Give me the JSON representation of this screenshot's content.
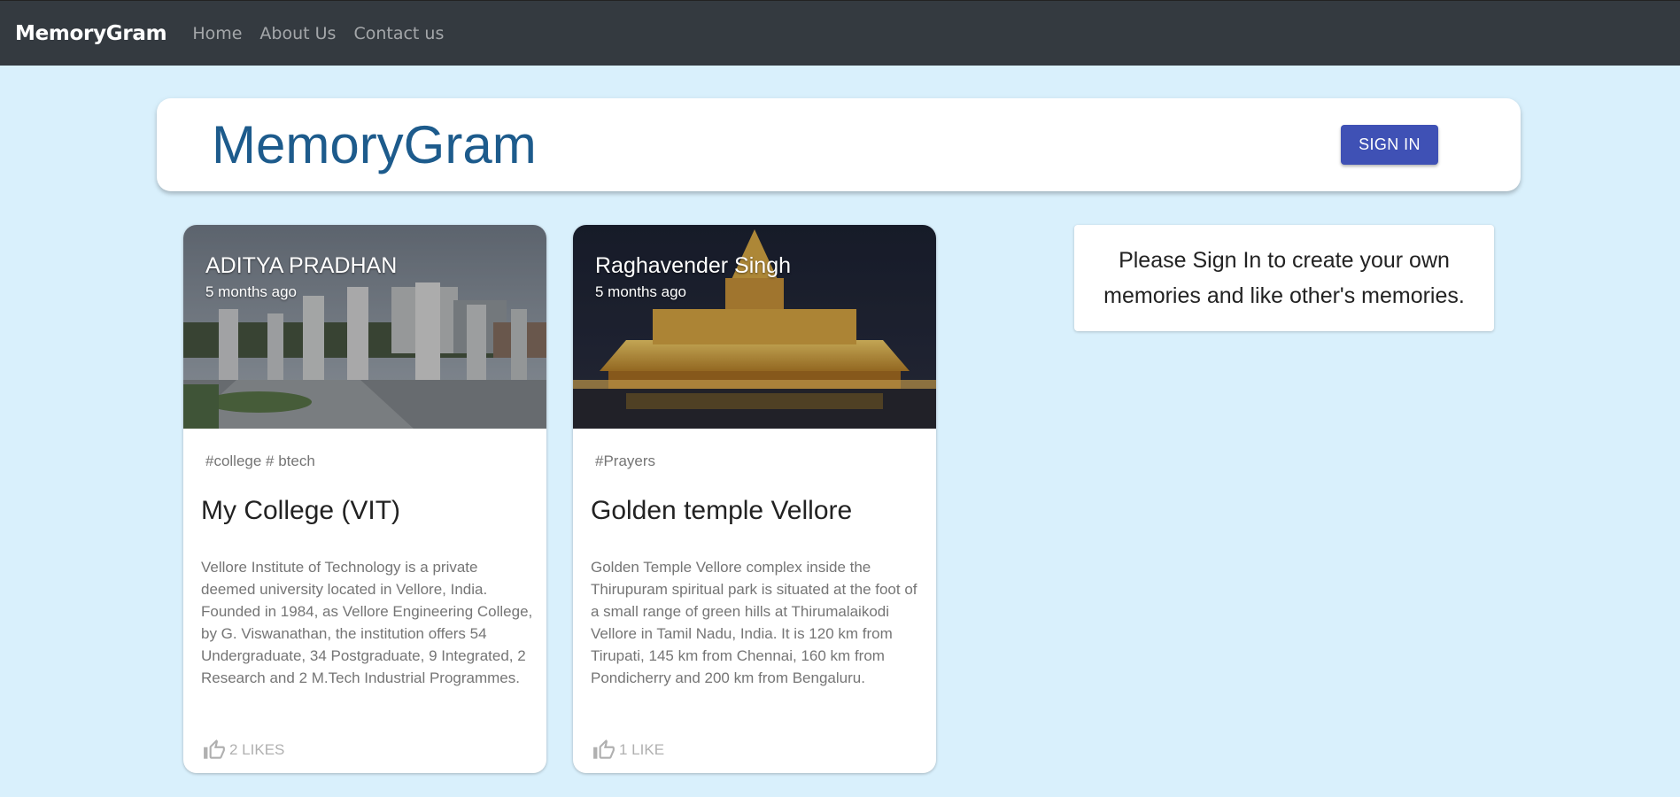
{
  "navbar": {
    "brand": "MemoryGram",
    "links": [
      "Home",
      "About Us",
      "Contact us"
    ]
  },
  "appbar": {
    "title": "MemoryGram",
    "signin_label": "SIGN IN"
  },
  "posts": [
    {
      "author": "ADITYA PRADHAN",
      "time": "5 months ago",
      "tags": "#college # btech",
      "title": "My College (VIT)",
      "description": "Vellore Institute of Technology is a private deemed university located in Vellore, India. Founded in 1984, as Vellore Engineering College, by G. Viswanathan, the institution offers 54 Undergraduate, 34 Postgraduate, 9 Integrated, 2 Research and 2 M.Tech Industrial Programmes.",
      "likes": "2 LIKES",
      "image": "college-campus-photo"
    },
    {
      "author": "Raghavender Singh",
      "time": "5 months ago",
      "tags": "#Prayers",
      "title": "Golden temple Vellore",
      "description": "Golden Temple Vellore complex inside the Thirupuram spiritual park is situated at the foot of a small range of green hills at Thirumalaikodi Vellore in Tamil Nadu, India. It is 120 km from Tirupati, 145 km from Chennai, 160 km from Pondicherry and 200 km from Bengaluru.",
      "likes": "1 LIKE",
      "image": "golden-temple-photo"
    }
  ],
  "signin_notice": "Please Sign In to create your own memories and like other's memories.",
  "colors": {
    "page_bg": "#d9f0fc",
    "navbar_bg": "#343a40",
    "title_blue": "#1d5b8c",
    "button_indigo": "#3f51b5"
  },
  "icons": {
    "like": "thumb-up-outline-icon"
  }
}
